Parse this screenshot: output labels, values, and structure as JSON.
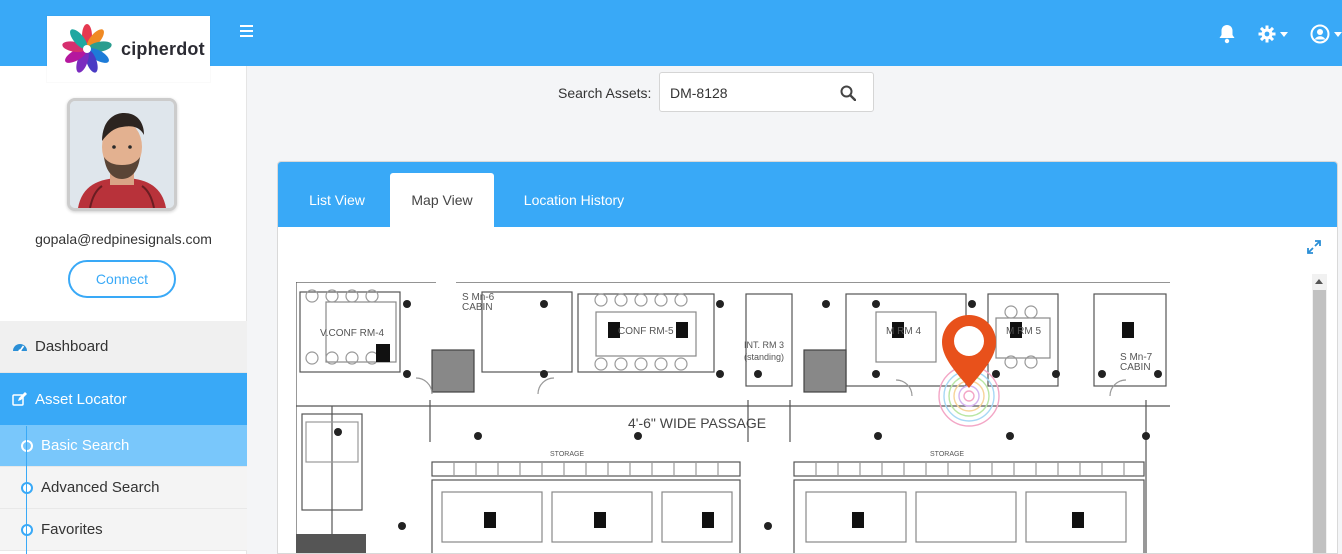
{
  "brand": {
    "name": "cipherdot"
  },
  "topbar": {
    "menu_icon": "hamburger-icon",
    "icons": [
      "bell-icon",
      "gear-icon",
      "user-circle-icon"
    ]
  },
  "profile": {
    "email": "gopala@redpinesignals.com",
    "connect_label": "Connect"
  },
  "nav": {
    "dashboard": {
      "label": "Dashboard",
      "icon": "dashboard-gauge-icon"
    },
    "asset_locator": {
      "label": "Asset Locator",
      "icon": "edit-icon"
    },
    "subitems": [
      {
        "label": "Basic Search",
        "selected": true
      },
      {
        "label": "Advanced Search",
        "selected": false
      },
      {
        "label": "Favorites",
        "selected": false
      }
    ]
  },
  "search": {
    "label": "Search Assets:",
    "value": "DM-8128",
    "icon": "search-icon"
  },
  "tabs": [
    {
      "label": "List View",
      "active": false
    },
    {
      "label": "Map View",
      "active": true
    },
    {
      "label": "Location History",
      "active": false
    }
  ],
  "map": {
    "labels": {
      "conf4": "V.CONF RM-4",
      "confRm": "CONF RM-5",
      "smMn6": "S Mn-6",
      "cabin1": "CABIN",
      "intRm": "INT. RM 3",
      "standing": "(standing)",
      "mrm4": "M RM 4",
      "mrm5": "M RM 5",
      "smMn7": "S Mn-7",
      "cabin2": "CABIN",
      "passage": "4'-6\" WIDE PASSAGE",
      "storage": "STORAGE"
    },
    "pin_color": "#e8511b",
    "pin_icon": "location-pin-icon",
    "expand_icon": "expand-icon"
  },
  "colors": {
    "primary": "#39a9f7",
    "active_sub": "#79c7fb"
  }
}
